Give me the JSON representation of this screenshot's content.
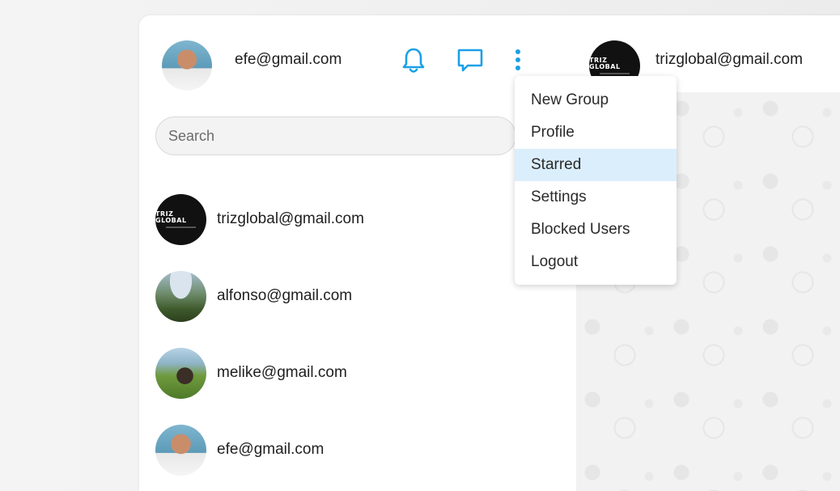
{
  "current_user": {
    "email": "efe@gmail.com",
    "avatar": "user-photo"
  },
  "header_icons": {
    "notifications": "bell-icon",
    "new_chat": "message-square-icon",
    "more": "more-vertical-icon",
    "accent_color": "#1aa0e8"
  },
  "search": {
    "placeholder": "Search",
    "value": ""
  },
  "contacts": [
    {
      "email": "trizglobal@gmail.com",
      "avatar": "triz-global-logo",
      "logo_text": "TRIZ GLOBAL"
    },
    {
      "email": "alfonso@gmail.com",
      "avatar": "landscape-photo"
    },
    {
      "email": "melike@gmail.com",
      "avatar": "park-photo"
    },
    {
      "email": "efe@gmail.com",
      "avatar": "user-photo"
    }
  ],
  "active_chat": {
    "email": "trizglobal@gmail.com",
    "avatar": "triz-global-logo",
    "logo_text": "TRIZ GLOBAL"
  },
  "menu": {
    "items": [
      {
        "label": "New Group"
      },
      {
        "label": "Profile"
      },
      {
        "label": "Starred",
        "highlighted": true
      },
      {
        "label": "Settings"
      },
      {
        "label": "Blocked Users"
      },
      {
        "label": "Logout"
      }
    ],
    "highlight_color": "#dbeefb"
  }
}
